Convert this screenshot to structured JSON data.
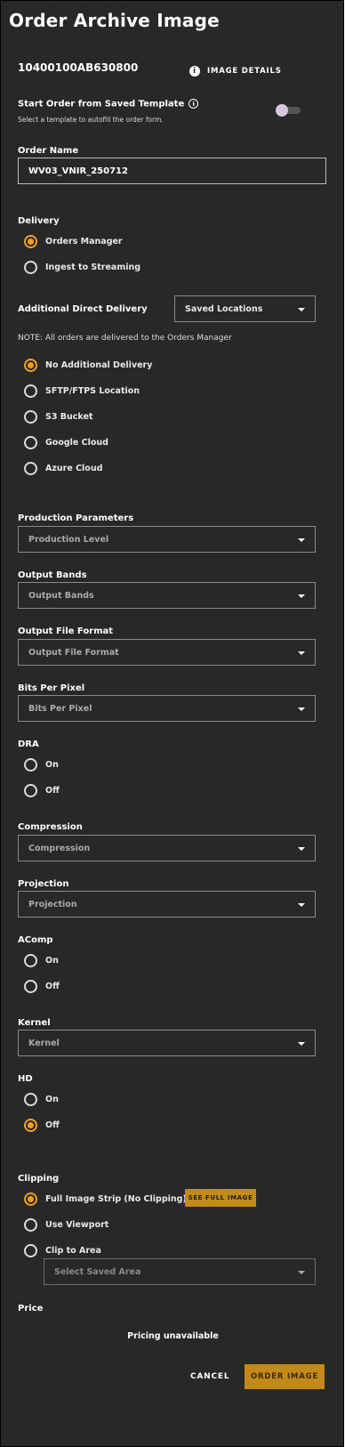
{
  "header": {
    "title": "Order Archive Image"
  },
  "image": {
    "catalog_id": "10400100AB630800",
    "details_label": "IMAGE DETAILS"
  },
  "template": {
    "label": "Start Order from Saved Template",
    "help": "Select a template to autofill the order form.",
    "enabled": false
  },
  "order_name": {
    "label": "Order Name",
    "value": "WV03_VNIR_250712"
  },
  "delivery": {
    "label": "Delivery",
    "options": [
      {
        "label": "Orders Manager",
        "selected": true
      },
      {
        "label": "Ingest to Streaming",
        "selected": false
      }
    ]
  },
  "additional_delivery": {
    "label": "Additional Direct Delivery",
    "select_value": "Saved Locations",
    "note": "NOTE: All orders are delivered to the Orders Manager",
    "options": [
      {
        "label": "No Additional Delivery",
        "selected": true
      },
      {
        "label": "SFTP/FTPS Location",
        "selected": false
      },
      {
        "label": "S3 Bucket",
        "selected": false
      },
      {
        "label": "Google Cloud",
        "selected": false
      },
      {
        "label": "Azure Cloud",
        "selected": false
      }
    ]
  },
  "production": {
    "label": "Production Parameters",
    "placeholder": "Production Level"
  },
  "output_bands": {
    "label": "Output Bands",
    "placeholder": "Output Bands"
  },
  "output_format": {
    "label": "Output File Format",
    "placeholder": "Output File Format"
  },
  "bits_per_pixel": {
    "label": "Bits Per Pixel",
    "placeholder": "Bits Per Pixel"
  },
  "dra": {
    "label": "DRA",
    "on": "On",
    "off": "Off",
    "selected": null
  },
  "compression": {
    "label": "Compression",
    "placeholder": "Compression"
  },
  "projection": {
    "label": "Projection",
    "placeholder": "Projection"
  },
  "acomp": {
    "label": "AComp",
    "on": "On",
    "off": "Off",
    "selected": null
  },
  "kernel": {
    "label": "Kernel",
    "placeholder": "Kernel"
  },
  "hd": {
    "label": "HD",
    "on": "On",
    "off": "Off",
    "selected": "Off"
  },
  "clipping": {
    "label": "Clipping",
    "full_strip": "Full Image Strip (No Clipping)",
    "see_full": "SEE FULL IMAGE",
    "viewport": "Use Viewport",
    "clip_area": "Clip to Area",
    "area_placeholder": "Select Saved Area",
    "selected": "Full Image Strip (No Clipping)"
  },
  "price": {
    "label": "Price",
    "value": "Pricing unavailable"
  },
  "actions": {
    "cancel": "CANCEL",
    "order": "ORDER IMAGE"
  },
  "colors": {
    "accent": "#f0a020",
    "button": "#c28a19",
    "panel": "#282828"
  }
}
